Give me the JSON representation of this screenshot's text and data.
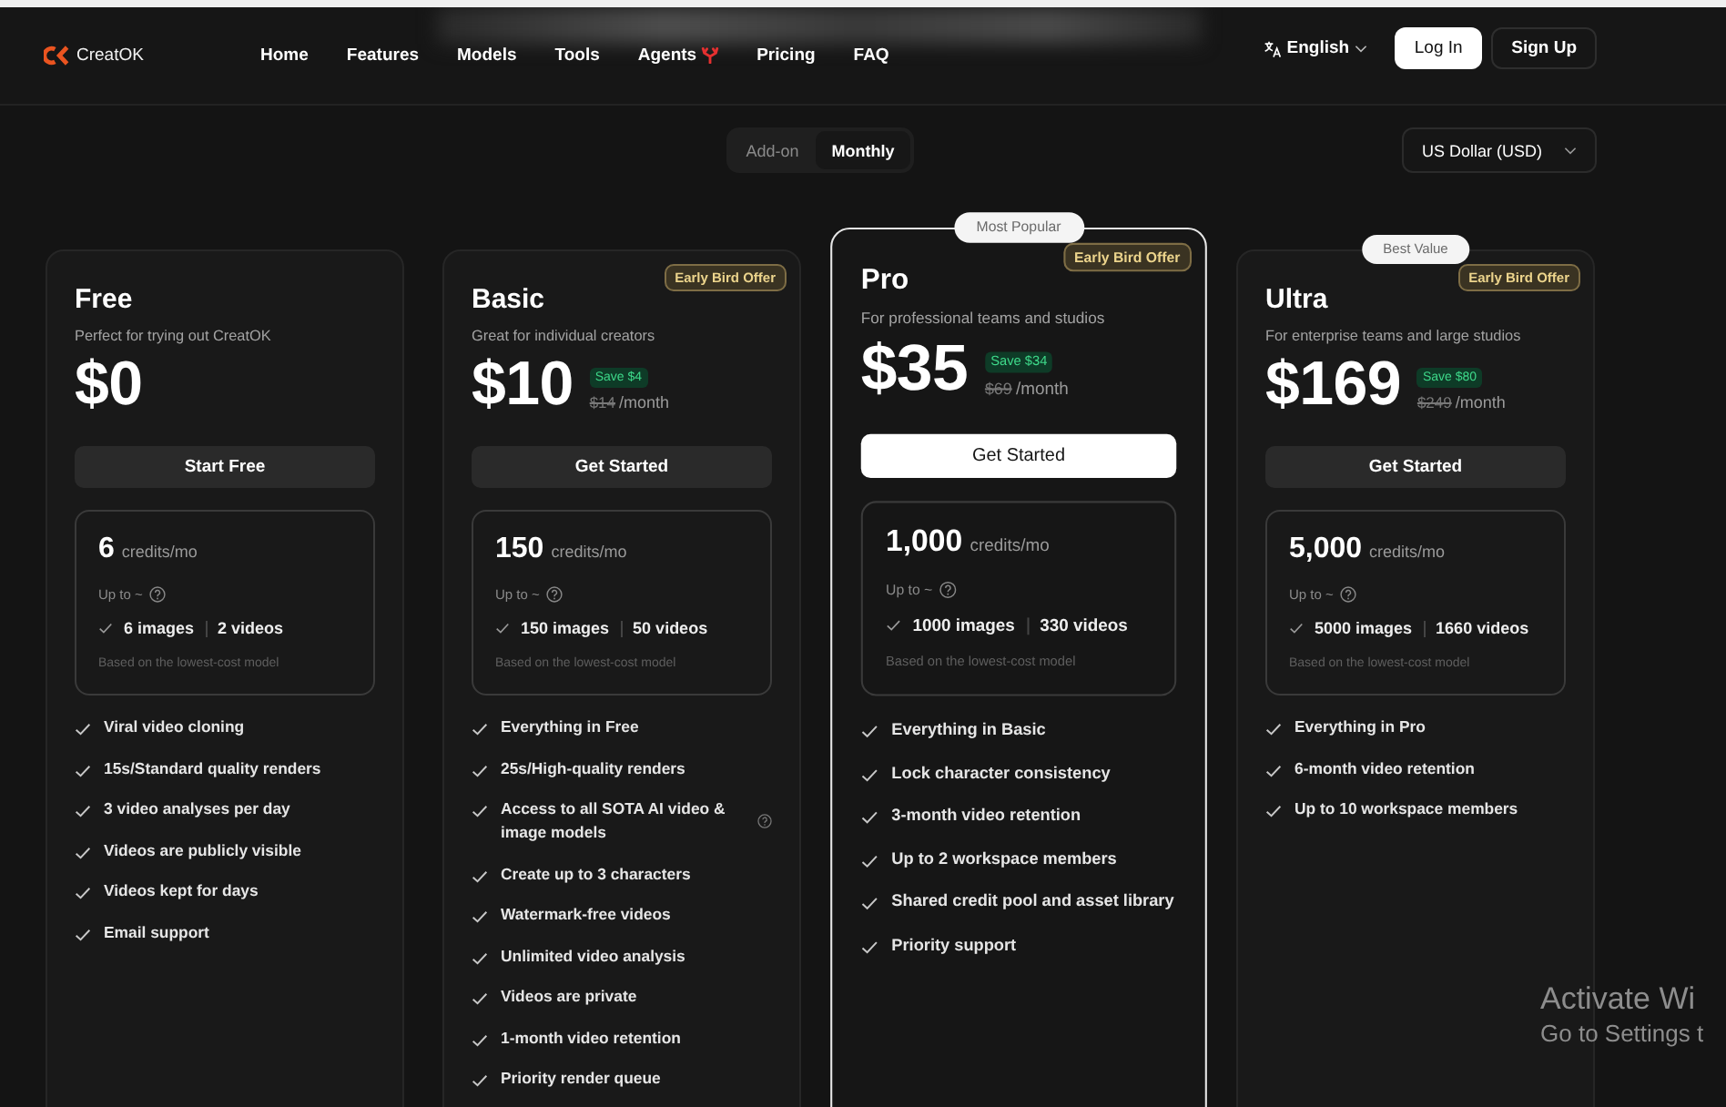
{
  "header": {
    "logo": "CreatOK",
    "nav": [
      {
        "label": "Home",
        "has_icon": false
      },
      {
        "label": "Features",
        "has_icon": false
      },
      {
        "label": "Models",
        "has_icon": false
      },
      {
        "label": "Tools",
        "has_icon": false
      },
      {
        "label": "Agents",
        "has_icon": true
      },
      {
        "label": "Pricing",
        "has_icon": false
      },
      {
        "label": "FAQ",
        "has_icon": false
      }
    ],
    "language": "English",
    "buttons": [
      {
        "label": "Log In",
        "kind": "primary"
      },
      {
        "label": "Sign Up",
        "kind": "secondary"
      }
    ]
  },
  "billing_toggle": [
    {
      "label": "Add-on",
      "selected": false
    },
    {
      "label": "Monthly",
      "selected": true
    }
  ],
  "currency": "US Dollar (USD)",
  "plans": [
    {
      "name": "Free",
      "highlighted": false,
      "description": "Perfect for trying out CreatOK",
      "price": "$0",
      "button": {
        "label": "Start Free",
        "kind": "secondary"
      },
      "credits": {
        "amount": "6",
        "unit": "credits/mo",
        "up_to": "Up to ~",
        "images": "6 images",
        "videos": "2 videos",
        "note": "Based on the lowest-cost model"
      },
      "features": [
        {
          "text": "Viral video cloning",
          "help": false
        },
        {
          "text": "15s/Standard quality renders",
          "help": false
        },
        {
          "text": "3 video analyses per day",
          "help": false
        },
        {
          "text": "Videos are publicly visible",
          "help": false
        },
        {
          "text": "Videos kept for days",
          "help": false
        },
        {
          "text": "Email support",
          "help": false
        }
      ]
    },
    {
      "name": "Basic",
      "highlighted": false,
      "offer_badge": "Early Bird Offer",
      "description": "Great for individual creators",
      "price": "$10",
      "save": "Save $4",
      "old_price": "$14",
      "period": "/month",
      "button": {
        "label": "Get Started",
        "kind": "secondary"
      },
      "credits": {
        "amount": "150",
        "unit": "credits/mo",
        "up_to": "Up to ~",
        "images": "150 images",
        "videos": "50 videos",
        "note": "Based on the lowest-cost model"
      },
      "features": [
        {
          "text": "Everything in Free",
          "help": false
        },
        {
          "text": "25s/High-quality renders",
          "help": false
        },
        {
          "text": "Access to all SOTA AI video & image models",
          "help": true
        },
        {
          "text": "Create up to 3 characters",
          "help": false
        },
        {
          "text": "Watermark-free videos",
          "help": false
        },
        {
          "text": "Unlimited video analysis",
          "help": false
        },
        {
          "text": "Videos are private",
          "help": false
        },
        {
          "text": "1-month video retention",
          "help": false
        },
        {
          "text": "Priority render queue",
          "help": false
        }
      ]
    },
    {
      "name": "Pro",
      "highlighted": true,
      "ribbon": "Most Popular",
      "offer_badge": "Early Bird Offer",
      "description": "For professional teams and studios",
      "price": "$35",
      "save": "Save $34",
      "old_price": "$69",
      "period": "/month",
      "button": {
        "label": "Get Started",
        "kind": "primary"
      },
      "credits": {
        "amount": "1,000",
        "unit": "credits/mo",
        "up_to": "Up to ~",
        "images": "1000 images",
        "videos": "330 videos",
        "note": "Based on the lowest-cost model"
      },
      "features": [
        {
          "text": "Everything in Basic",
          "help": false
        },
        {
          "text": "Lock character consistency",
          "help": false
        },
        {
          "text": "3-month video retention",
          "help": false
        },
        {
          "text": "Up to 2 workspace members",
          "help": false
        },
        {
          "text": "Shared credit pool and asset library",
          "help": false
        },
        {
          "text": "Priority support",
          "help": false
        }
      ]
    },
    {
      "name": "Ultra",
      "highlighted": false,
      "ribbon": "Best Value",
      "offer_badge": "Early Bird Offer",
      "description": "For enterprise teams and large studios",
      "price": "$169",
      "save": "Save $80",
      "old_price": "$249",
      "period": "/month",
      "button": {
        "label": "Get Started",
        "kind": "secondary"
      },
      "credits": {
        "amount": "5,000",
        "unit": "credits/mo",
        "up_to": "Up to ~",
        "images": "5000 images",
        "videos": "1660 videos",
        "note": "Based on the lowest-cost model"
      },
      "features": [
        {
          "text": "Everything in Pro",
          "help": false
        },
        {
          "text": "6-month video retention",
          "help": false
        },
        {
          "text": "Up to 10 workspace members",
          "help": false
        }
      ]
    }
  ],
  "os_notice": {
    "title": "Activate Wi",
    "text": "Go to Settings t"
  }
}
